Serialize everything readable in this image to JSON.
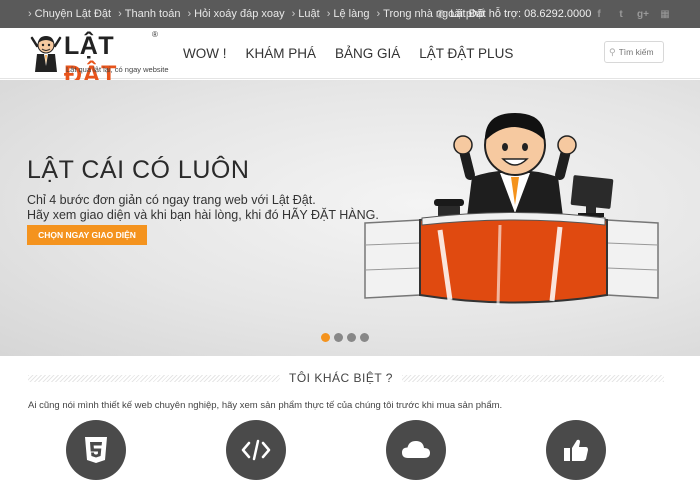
{
  "topbar": {
    "links": [
      "Chuyện Lật Đật",
      "Thanh toán",
      "Hỏi xoáy đáp xoay",
      "Luật",
      "Lệ làng",
      "Trong nhà ngoài phố"
    ],
    "support_text": "Lật Đật hỗ trợ: 08.6292.0000",
    "social_icons": [
      "facebook-icon",
      "twitter-icon",
      "google-plus-icon",
      "grid-icon"
    ],
    "separator": "›"
  },
  "header": {
    "logo_brand_prefix": "LẬT ",
    "logo_brand_accent": "ĐẬT",
    "logo_trademark": "®",
    "logo_tagline": "Lật qua lật lại, có ngay website",
    "nav": [
      "WOW !",
      "KHÁM PHÁ",
      "BẢNG GIÁ",
      "LẬT ĐẬT PLUS"
    ],
    "search_placeholder": "Tìm kiếm"
  },
  "hero": {
    "headline": "LẬT CÁI CÓ LUÔN",
    "line1": "Chỉ 4 bước đơn giản có ngay trang web với Lật Đật.",
    "line2": "Hãy xem giao diện và khi bạn hài lòng, khi đó HÃY ĐẶT HÀNG.",
    "cta_label": "CHỌN NGAY GIAO DIỆN",
    "slides_count": 4,
    "active_slide": 1
  },
  "section": {
    "title": "TÔI KHÁC BIỆT ?",
    "description": "Ai cũng nói mình thiết kế web chuyên nghiệp, hãy xem sản phẩm thực tế của chúng tôi trước khi mua sản phẩm.",
    "features": [
      "html5-icon",
      "code-icon",
      "cloud-icon",
      "thumbs-up-icon"
    ]
  },
  "colors": {
    "accent": "#f4931e",
    "topbar_bg": "#5a5a5a",
    "feature_circle": "#4a4a4a",
    "logo_accent": "#e8541b"
  }
}
